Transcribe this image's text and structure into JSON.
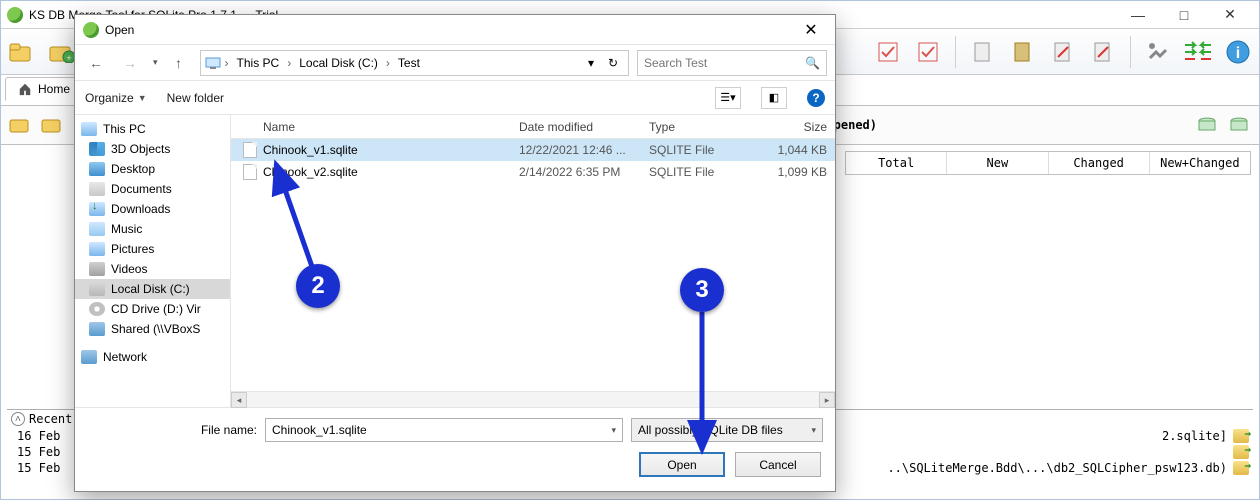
{
  "app": {
    "title": "KS DB Merge Tool for SQLite Pro 1.7.1 — Trial",
    "ribbon_tab": "Home",
    "status_not_opened": "(not opened)",
    "right_columns": [
      "Total",
      "New",
      "Changed",
      "New+Changed"
    ],
    "recent_header": "Recent",
    "log_lines": [
      {
        "time": "16 Feb",
        "rest": "2.sqlite]"
      },
      {
        "time": "15 Feb",
        "rest": ""
      },
      {
        "time": "15 Feb",
        "rest": "..\\SQLiteMerge.Bdd\\...\\db2_SQLCipher_psw123.db)"
      }
    ],
    "window_buttons": {
      "min": "—",
      "max": "□",
      "close": "✕"
    }
  },
  "dialog": {
    "title": "Open",
    "nav": {
      "back": "←",
      "fwd": "→",
      "up": "↑"
    },
    "breadcrumbs": [
      "This PC",
      "Local Disk (C:)",
      "Test"
    ],
    "refresh": "↻",
    "search_placeholder": "Search Test",
    "toolbar": {
      "organize": "Organize",
      "new_folder": "New folder",
      "help": "?"
    },
    "tree": [
      {
        "label": "This PC",
        "icon": "ico-pc",
        "top": true
      },
      {
        "label": "3D Objects",
        "icon": "ico-3d"
      },
      {
        "label": "Desktop",
        "icon": "ico-desktop"
      },
      {
        "label": "Documents",
        "icon": "ico-docs"
      },
      {
        "label": "Downloads",
        "icon": "ico-dl"
      },
      {
        "label": "Music",
        "icon": "ico-music"
      },
      {
        "label": "Pictures",
        "icon": "ico-pics"
      },
      {
        "label": "Videos",
        "icon": "ico-vids"
      },
      {
        "label": "Local Disk (C:)",
        "icon": "ico-drive",
        "sel": true
      },
      {
        "label": "CD Drive (D:) Vir",
        "icon": "ico-cd"
      },
      {
        "label": "Shared (\\\\VBoxS",
        "icon": "ico-net"
      },
      {
        "label": "Network",
        "icon": "ico-net",
        "top": true
      }
    ],
    "columns": {
      "name": "Name",
      "date": "Date modified",
      "type": "Type",
      "size": "Size"
    },
    "files": [
      {
        "name": "Chinook_v1.sqlite",
        "date": "12/22/2021 12:46 ...",
        "type": "SQLITE File",
        "size": "1,044 KB",
        "sel": true
      },
      {
        "name": "Chinook_v2.sqlite",
        "date": "2/14/2022 6:35 PM",
        "type": "SQLITE File",
        "size": "1,099 KB",
        "sel": false
      }
    ],
    "file_name_label": "File name:",
    "file_name_value": "Chinook_v1.sqlite",
    "filter": "All possibly SQLite DB files",
    "open": "Open",
    "cancel": "Cancel"
  },
  "annotations": {
    "step2": "2",
    "step3": "3"
  }
}
